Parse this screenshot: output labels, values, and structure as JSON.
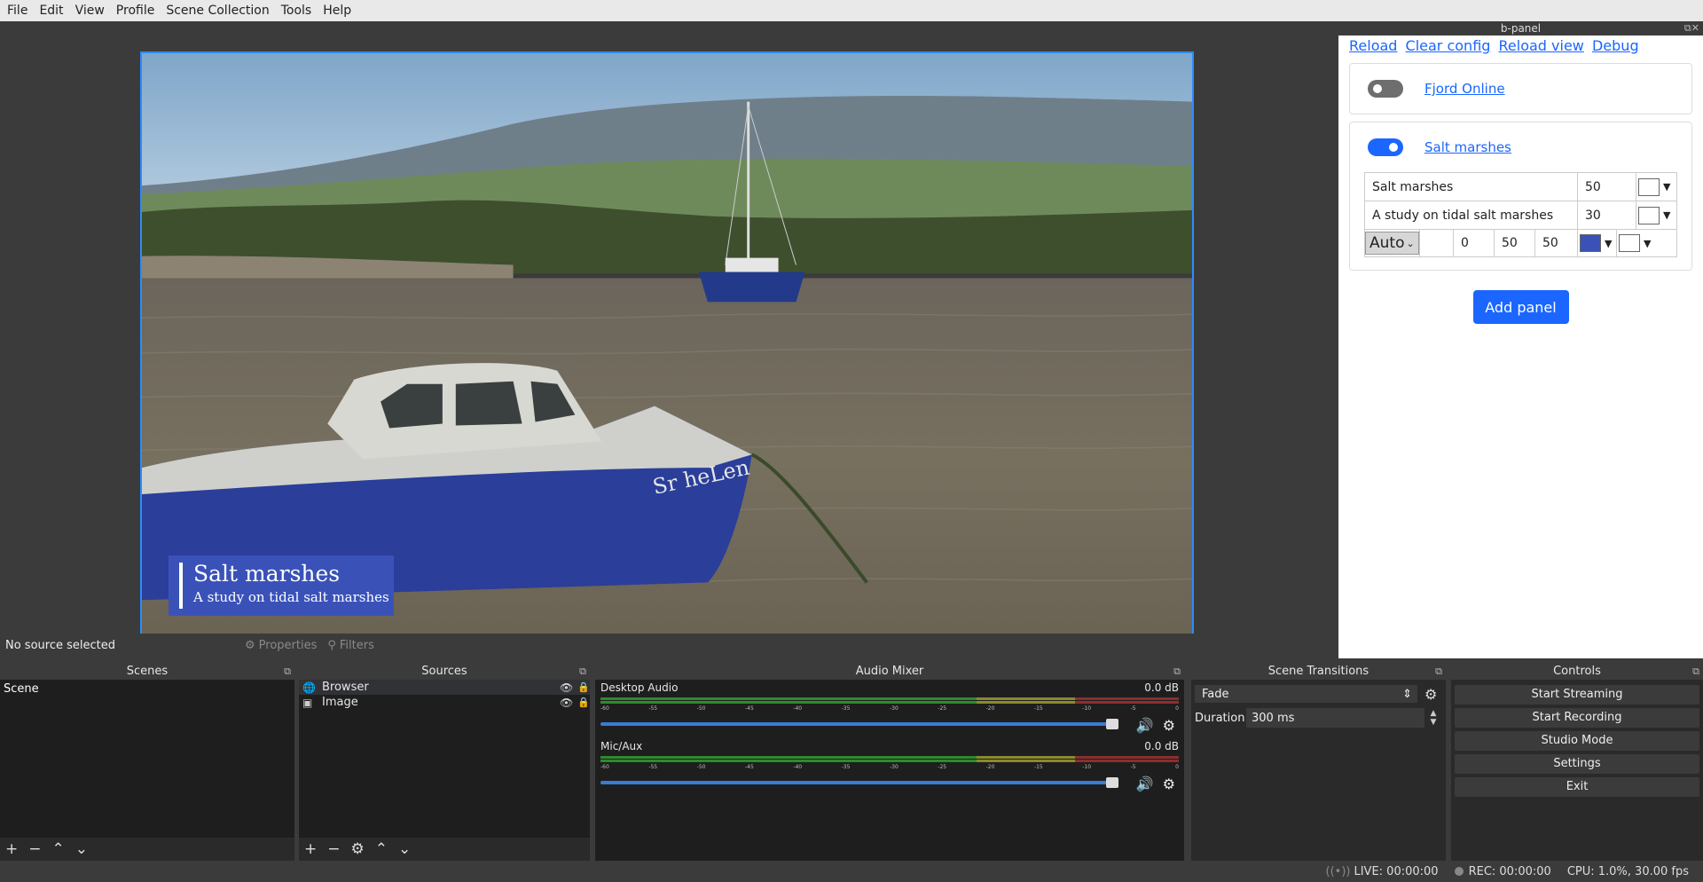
{
  "menu": [
    "File",
    "Edit",
    "View",
    "Profile",
    "Scene Collection",
    "Tools",
    "Help"
  ],
  "preview": {
    "lower_third_title": "Salt marshes",
    "lower_third_subtitle": "A study on tidal salt marshes",
    "boat_name": "Sr heLen"
  },
  "context": {
    "no_source": "No source selected",
    "properties": "Properties",
    "filters": "Filters"
  },
  "bpanel": {
    "title": "b-panel",
    "links": [
      "Reload",
      "Clear config",
      "Reload view",
      "Debug"
    ],
    "cards": [
      {
        "label": "Fjord Online",
        "enabled": false
      },
      {
        "label": "Salt marshes",
        "enabled": true
      }
    ],
    "fields": {
      "title_text": "Salt marshes",
      "title_size": "50",
      "subtitle_text": "A study on tidal salt marshes",
      "subtitle_size": "30",
      "mode": "Auto",
      "v1": "0",
      "v2": "50",
      "v3": "50",
      "accent_color": "#3a52b8"
    },
    "add_panel": "Add panel"
  },
  "scenes": {
    "title": "Scenes",
    "items": [
      "Scene"
    ]
  },
  "sources": {
    "title": "Sources",
    "items": [
      {
        "name": "Browser",
        "icon": "globe-icon"
      },
      {
        "name": "Image",
        "icon": "image-icon"
      }
    ]
  },
  "mixer": {
    "title": "Audio Mixer",
    "channels": [
      {
        "name": "Desktop Audio",
        "level": "0.0 dB",
        "fader": 1.0
      },
      {
        "name": "Mic/Aux",
        "level": "0.0 dB",
        "fader": 1.0
      }
    ],
    "ticks": [
      "-60",
      "-55",
      "-50",
      "-45",
      "-40",
      "-35",
      "-30",
      "-25",
      "-20",
      "-15",
      "-10",
      "-5",
      "0"
    ]
  },
  "transitions": {
    "title": "Scene Transitions",
    "selected": "Fade",
    "duration_label": "Duration",
    "duration": "300 ms"
  },
  "controls": {
    "title": "Controls",
    "buttons": [
      "Start Streaming",
      "Start Recording",
      "Studio Mode",
      "Settings",
      "Exit"
    ]
  },
  "status": {
    "live": "LIVE: 00:00:00",
    "rec": "REC: 00:00:00",
    "cpu": "CPU: 1.0%, 30.00 fps"
  }
}
